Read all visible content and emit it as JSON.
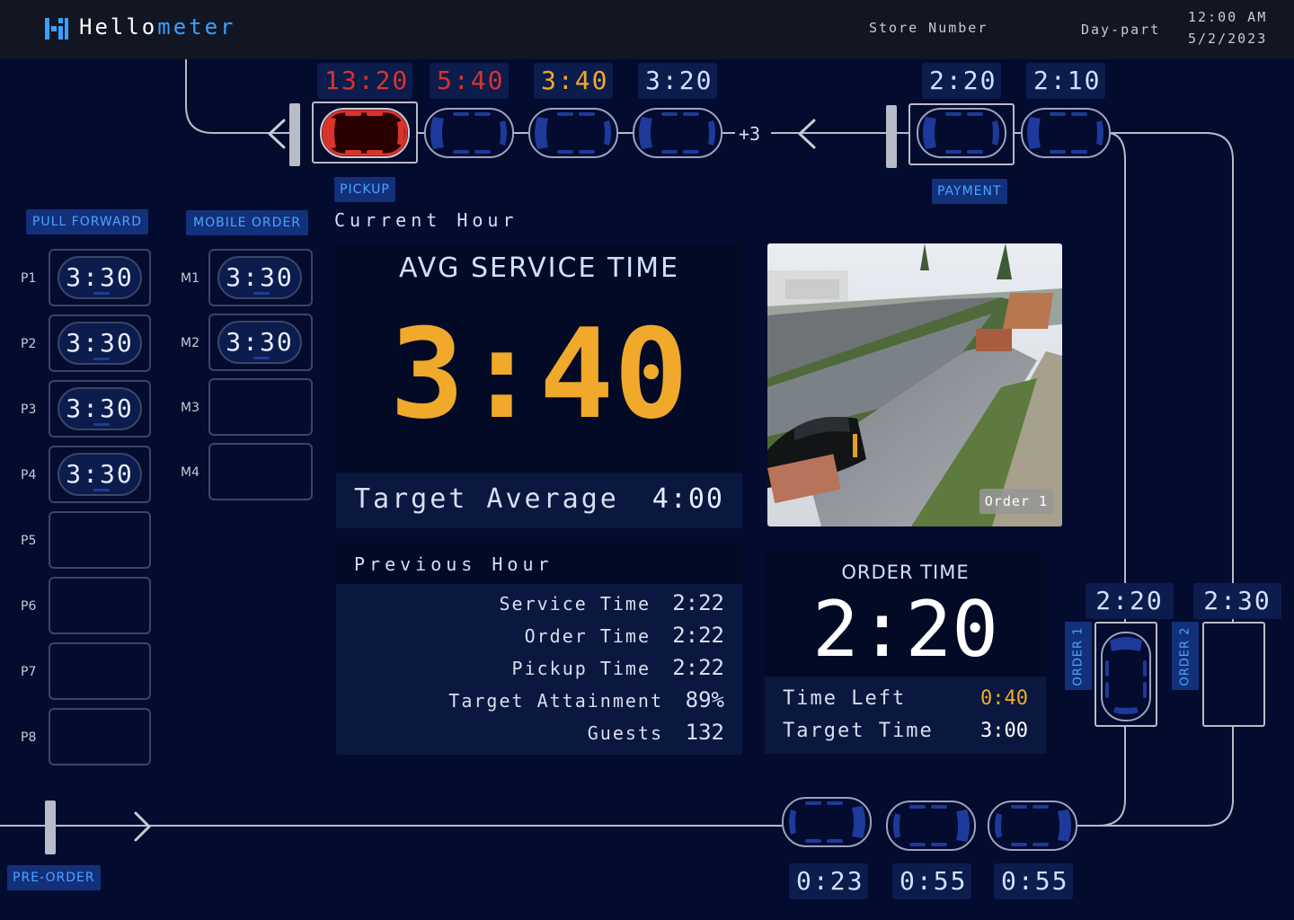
{
  "header": {
    "brand_prefix": "Hello",
    "brand_suffix": "meter",
    "store_number_label": "Store Number",
    "daypart_label": "Day-part",
    "time": "12:00 AM",
    "date": "5/2/2023"
  },
  "top_lane": {
    "cars": [
      {
        "timer": "13:20",
        "status": "late",
        "color": "#d8342c"
      },
      {
        "timer": "5:40",
        "status": "late",
        "color": "#d8342c"
      },
      {
        "timer": "3:40",
        "status": "warning",
        "color": "#f0a92a"
      },
      {
        "timer": "3:20",
        "status": "ok",
        "color": "#cfe0ff"
      },
      {
        "timer": "2:20",
        "status": "ok",
        "color": "#cfe0ff"
      },
      {
        "timer": "2:10",
        "status": "ok",
        "color": "#cfe0ff"
      }
    ],
    "overflow_count": "+3",
    "pickup_label": "PICKUP",
    "payment_label": "PAYMENT"
  },
  "pull_forward": {
    "title": "PULL FORWARD",
    "slots": [
      {
        "label": "P1",
        "value": "3:30"
      },
      {
        "label": "P2",
        "value": "3:30"
      },
      {
        "label": "P3",
        "value": "3:30"
      },
      {
        "label": "P4",
        "value": "3:30"
      },
      {
        "label": "P5",
        "value": ""
      },
      {
        "label": "P6",
        "value": ""
      },
      {
        "label": "P7",
        "value": ""
      },
      {
        "label": "P8",
        "value": ""
      }
    ]
  },
  "mobile_order": {
    "title": "MOBILE ORDER",
    "slots": [
      {
        "label": "M1",
        "value": "3:30"
      },
      {
        "label": "M2",
        "value": "3:30"
      },
      {
        "label": "M3",
        "value": ""
      },
      {
        "label": "M4",
        "value": ""
      }
    ]
  },
  "current_hour": {
    "title": "Current Hour",
    "avg_label": "AVG SERVICE TIME",
    "avg_value": "3:40",
    "target_label": "Target Average",
    "target_value": "4:00"
  },
  "previous_hour": {
    "title": "Previous Hour",
    "rows": [
      {
        "label": "Service Time",
        "value": "2:22"
      },
      {
        "label": "Order Time",
        "value": "2:22"
      },
      {
        "label": "Pickup Time",
        "value": "2:22"
      },
      {
        "label": "Target Attainment",
        "value": "89%"
      },
      {
        "label": "Guests",
        "value": "132"
      }
    ]
  },
  "camera": {
    "badge": "Order 1"
  },
  "order_time": {
    "title": "ORDER TIME",
    "value": "2:20",
    "time_left_label": "Time Left",
    "time_left_value": "0:40",
    "target_label": "Target Time",
    "target_value": "3:00"
  },
  "order_lanes": [
    {
      "label": "ORDER 1",
      "timer": "2:20"
    },
    {
      "label": "ORDER 2",
      "timer": "2:30"
    }
  ],
  "bottom_lane": {
    "timers": [
      "0:23",
      "0:55",
      "0:55"
    ],
    "preorder_label": "PRE-ORDER"
  },
  "colors": {
    "accent": "#3aa0ff",
    "warning": "#f0a92a",
    "late": "#d8342c",
    "car_body": "#1d3a9a",
    "background": "#030b2e"
  }
}
